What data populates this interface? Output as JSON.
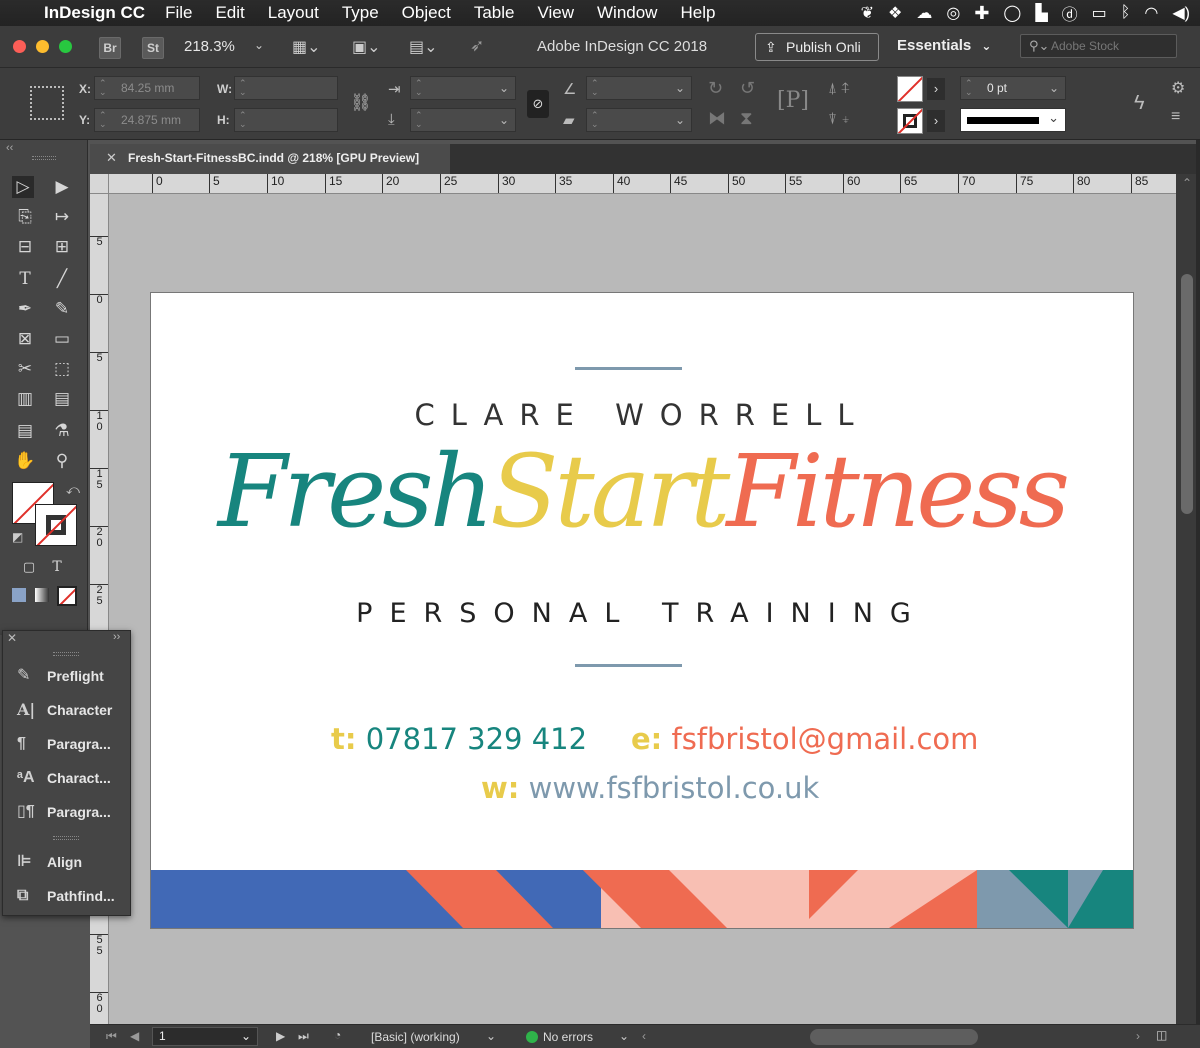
{
  "menubar": {
    "app_name": "InDesign CC",
    "items": [
      "File",
      "Edit",
      "Layout",
      "Type",
      "Object",
      "Table",
      "View",
      "Window",
      "Help"
    ]
  },
  "appbar": {
    "br_label": "Br",
    "st_label": "St",
    "zoom": "218.3%",
    "title": "Adobe InDesign CC 2018",
    "publish_label": "Publish Onli",
    "workspace": "Essentials",
    "search_placeholder": "Adobe Stock"
  },
  "control": {
    "x_label": "X:",
    "y_label": "Y:",
    "w_label": "W:",
    "h_label": "H:",
    "x_value": "84.25 mm",
    "y_value": "24.875 mm",
    "stroke_weight": "0 pt"
  },
  "document": {
    "tab_title": "Fresh-Start-FitnessBC.indd @ 218% [GPU Preview]"
  },
  "rulers": {
    "h_ticks": [
      "0",
      "5",
      "10",
      "15",
      "20",
      "25",
      "30",
      "35",
      "40",
      "45",
      "50",
      "55",
      "60",
      "65",
      "70",
      "75",
      "80",
      "85"
    ],
    "v_ticks": [
      "5",
      "0",
      "5",
      "1\n0",
      "1\n5",
      "2\n0",
      "2\n5",
      "5\n5",
      "6\n0"
    ]
  },
  "card": {
    "name": "CLARE WORRELL",
    "brand_fresh": "Fresh",
    "brand_start": "Start",
    "brand_fitness": "Fitness",
    "tagline": "PERSONAL TRAINING",
    "phone_label": "t:",
    "phone": "07817 329 412",
    "email_label": "e:",
    "email": "fsfbristol@gmail.com",
    "web_label": "w:",
    "web": "www.fsfbristol.co.uk"
  },
  "colors": {
    "teal": "#17857e",
    "yellow": "#e8cb4b",
    "coral": "#ef6b51",
    "slate": "#7e99ad",
    "blue": "#4169b6",
    "pink": "#f8bfb3"
  },
  "panel": {
    "items": [
      "Preflight",
      "Character",
      "Paragra...",
      "Charact...",
      "Paragra...",
      "Align",
      "Pathfind..."
    ]
  },
  "status": {
    "page": "1",
    "profile": "[Basic] (working)",
    "errors": "No errors"
  }
}
